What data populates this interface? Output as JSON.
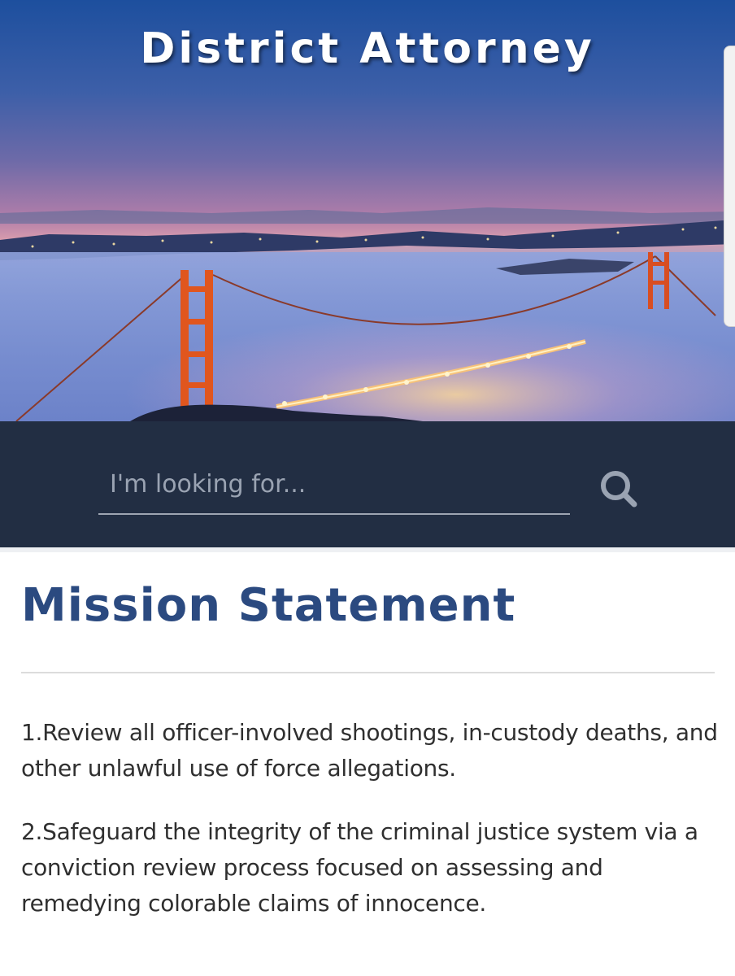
{
  "header": {
    "title": "District Attorney"
  },
  "search": {
    "placeholder": "I'm looking for..."
  },
  "mission": {
    "title": "Mission Statement",
    "items": [
      "1.Review all officer-involved shootings, in-custody deaths, and other unlawful use of force allegations.",
      "2.Safeguard the integrity of the criminal justice system via a conviction review process focused on assessing and remedying colorable claims of innocence."
    ]
  },
  "colors": {
    "band": "#222e43",
    "heading": "#2b4a80",
    "text": "#2f2f2f",
    "bridge": "#e0561e"
  }
}
